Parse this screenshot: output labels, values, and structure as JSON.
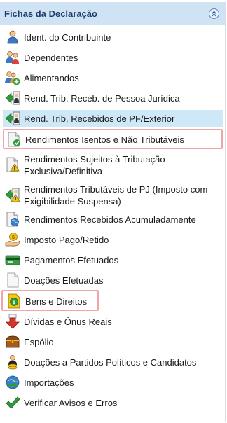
{
  "panel": {
    "title": "Fichas da Declaração",
    "collapse_icon": "double-chevron-up-icon"
  },
  "items": [
    {
      "label": "Ident. do Contribuinte",
      "icon": "person-icon"
    },
    {
      "label": "Dependentes",
      "icon": "people-icon"
    },
    {
      "label": "Alimentandos",
      "icon": "people-plus-icon"
    },
    {
      "label": "Rend. Trib. Receb. de Pessoa Jurídica",
      "icon": "arrow-person-icon"
    },
    {
      "label": "Rend. Trib. Recebidos de PF/Exterior",
      "icon": "arrow-person-icon",
      "selected": true
    },
    {
      "label": "Rendimentos Isentos e Não Tributáveis",
      "icon": "document-check-icon",
      "highlighted": true
    },
    {
      "label": "Rendimentos Sujeitos à Tributação Exclusiva/Definitiva",
      "icon": "document-warning-icon"
    },
    {
      "label": "Rendimentos Tributáveis de PJ (Imposto com Exigibilidade Suspensa)",
      "icon": "arrow-warning-icon"
    },
    {
      "label": "Rendimentos Recebidos Acumuladamente",
      "icon": "document-globe-icon"
    },
    {
      "label": "Imposto Pago/Retido",
      "icon": "hand-coin-icon"
    },
    {
      "label": "Pagamentos Efetuados",
      "icon": "credit-card-icon"
    },
    {
      "label": "Doações Efetuadas",
      "icon": "document-icon"
    },
    {
      "label": "Bens e Direitos",
      "icon": "dollar-document-icon",
      "highlighted": true
    },
    {
      "label": "Dívidas e Ônus Reais",
      "icon": "red-arrow-down-icon"
    },
    {
      "label": "Espólio",
      "icon": "treasure-chest-icon"
    },
    {
      "label": "Doações a Partidos Políticos e Candidatos",
      "icon": "person-coins-icon"
    },
    {
      "label": "Importações",
      "icon": "import-icon"
    },
    {
      "label": "Verificar Avisos e Erros",
      "icon": "green-check-icon"
    }
  ]
}
